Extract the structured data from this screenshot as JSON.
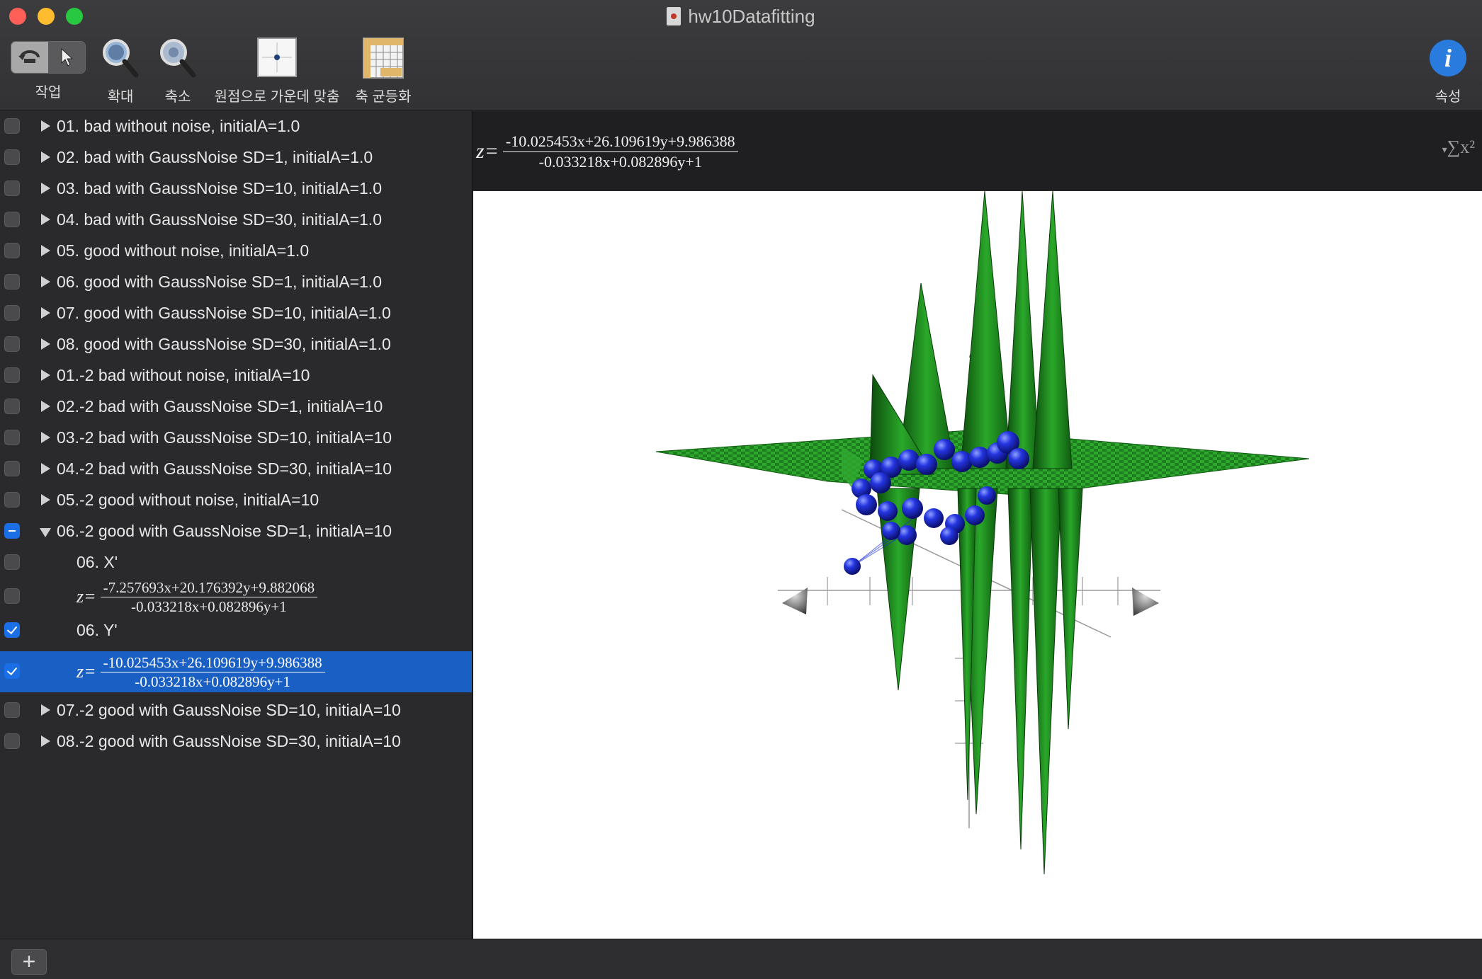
{
  "window": {
    "title": "hw10Datafitting"
  },
  "toolbar": {
    "action_label": "작업",
    "zoom_in_label": "확대",
    "zoom_out_label": "축소",
    "center_origin_label": "원점으로 가운데 맞춤",
    "equalize_axes_label": "축 균등화",
    "properties_label": "속성"
  },
  "sidebar": {
    "items": [
      {
        "label": "01. bad without noise, initialA=1.0"
      },
      {
        "label": "02. bad with GaussNoise SD=1, initialA=1.0"
      },
      {
        "label": "03. bad with GaussNoise SD=10, initialA=1.0"
      },
      {
        "label": "04. bad with GaussNoise SD=30, initialA=1.0"
      },
      {
        "label": "05. good without noise, initialA=1.0"
      },
      {
        "label": "06. good with GaussNoise SD=1, initialA=1.0"
      },
      {
        "label": "07. good with GaussNoise SD=10, initialA=1.0"
      },
      {
        "label": "08. good with GaussNoise SD=30, initialA=1.0"
      },
      {
        "label": "01.-2 bad without noise, initialA=10"
      },
      {
        "label": "02.-2 bad with GaussNoise SD=1, initialA=10"
      },
      {
        "label": "03.-2 bad with GaussNoise SD=10, initialA=10"
      },
      {
        "label": "04.-2 bad with GaussNoise SD=30, initialA=10"
      },
      {
        "label": "05.-2 good without noise, initialA=10"
      },
      {
        "label": "06.-2 good with GaussNoise SD=1, initialA=10"
      },
      {
        "label": "07.-2 good with GaussNoise SD=10, initialA=10"
      },
      {
        "label": "08.-2 good with GaussNoise SD=30, initialA=10"
      }
    ],
    "children": {
      "x_label": "06. X'",
      "x_formula": {
        "z": "z=",
        "num": "-7.257693x+20.176392y+9.882068",
        "den": "-0.033218x+0.082896y+1"
      },
      "y_label": "06. Y'",
      "y_formula": {
        "z": "z=",
        "num": "-10.025453x+26.109619y+9.986388",
        "den": "-0.033218x+0.082896y+1"
      }
    }
  },
  "equation_bar": {
    "z": "z=",
    "num": "-10.025453x+26.109619y+9.986388",
    "den": "-0.033218x+0.082896y+1",
    "sigma": "∑x²"
  },
  "bottom": {
    "add_label": "+"
  },
  "colors": {
    "surface": "#1f8a1f",
    "points": "#1a2fd6",
    "selection": "#1a5fc4",
    "accent": "#2a7bde"
  },
  "icons": [
    "rotate-icon",
    "pointer-icon",
    "zoom-in-icon",
    "zoom-out-icon",
    "center-origin-icon",
    "equalize-axes-icon",
    "info-icon",
    "document-icon",
    "disclosure-triangle-icon",
    "add-icon"
  ]
}
